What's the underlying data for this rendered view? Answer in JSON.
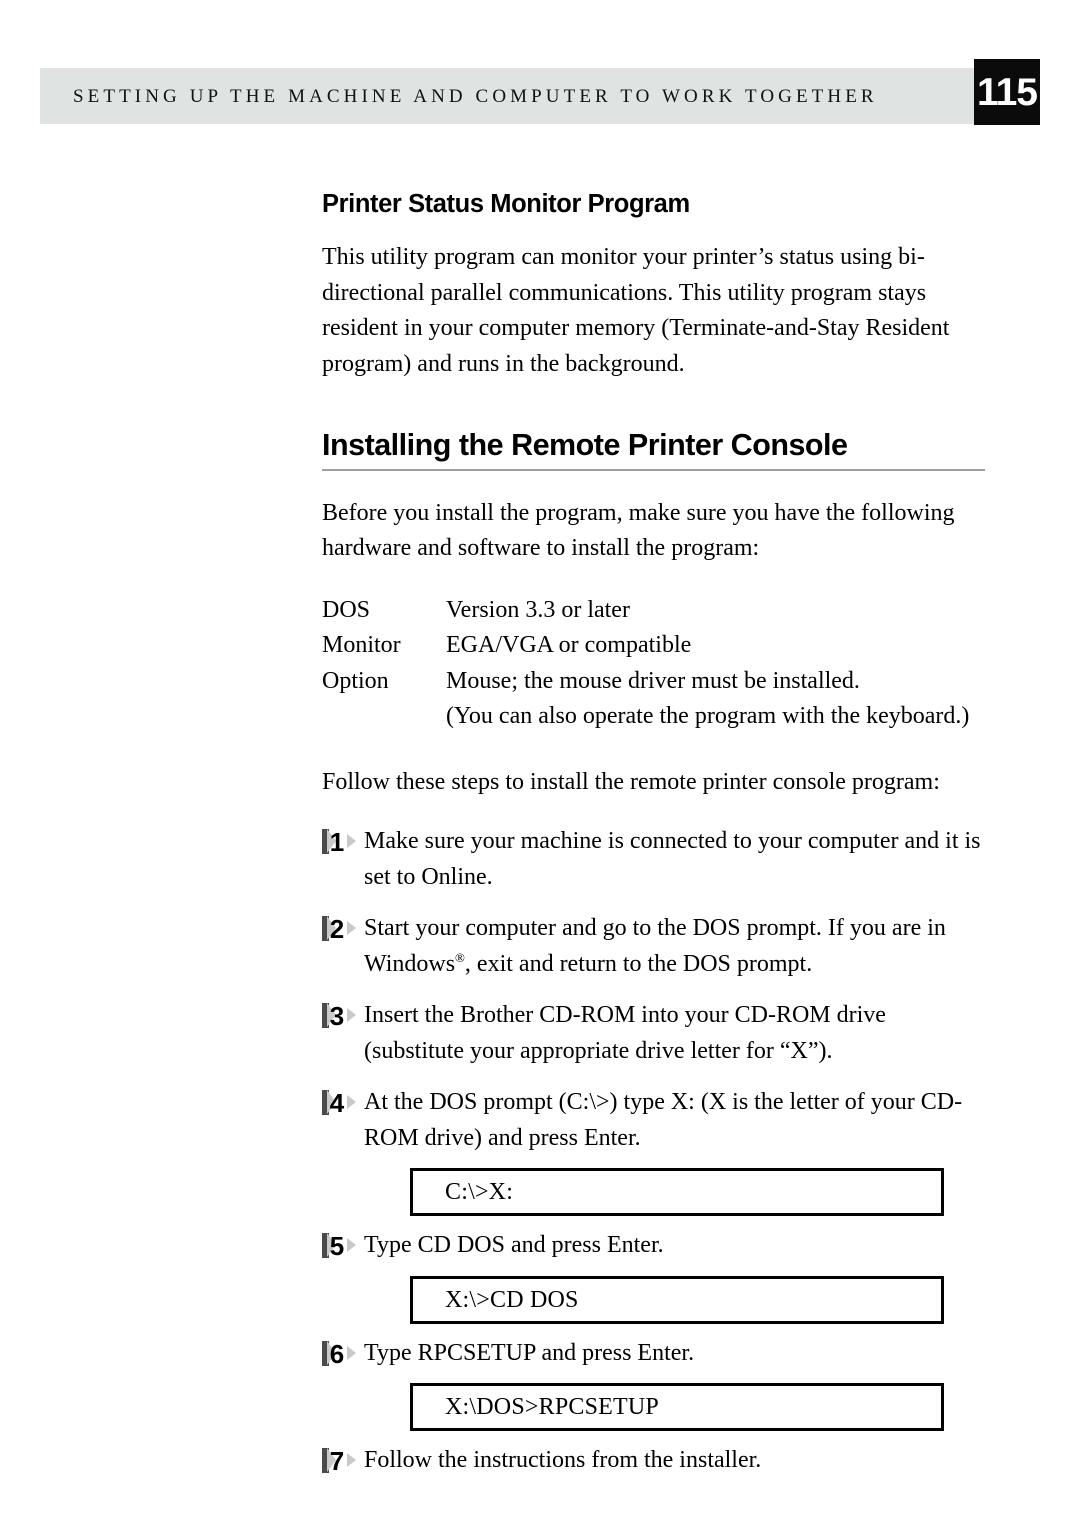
{
  "header": {
    "running_title": "SETTING UP THE  MACHINE AND COMPUTER TO WORK TOGETHER",
    "page_number": "115"
  },
  "sections": {
    "monitor": {
      "heading": "Printer Status Monitor Program",
      "paragraph": "This utility program can monitor your printer’s status using bi-directional parallel communications. This utility program stays resident in your computer memory (Terminate-and-Stay Resident program) and runs in the background."
    },
    "console": {
      "heading": "Installing the Remote Printer Console",
      "intro": "Before you install the program, make sure you have the following hardware and software to install the program:",
      "requirements": [
        {
          "label": "DOS",
          "value": "Version 3.3 or later"
        },
        {
          "label": "Monitor",
          "value": "EGA/VGA or compatible"
        },
        {
          "label": "Option",
          "value": "Mouse; the mouse driver must be installed."
        },
        {
          "label": "",
          "value": "(You can also operate the program with the keyboard.)"
        }
      ],
      "steps_intro": "Follow these steps to install the remote printer console program:",
      "steps": [
        {
          "number": "1",
          "text": "Make sure your machine is connected to your computer and it is set to Online."
        },
        {
          "number": "2",
          "text_before": "Start your computer and go to the DOS prompt. If you are in Windows",
          "superscript": "®",
          "text_after": ", exit and return to the DOS prompt."
        },
        {
          "number": "3",
          "text": "Insert the Brother CD-ROM into your CD-ROM drive (substitute your appropriate drive letter for “X”)."
        },
        {
          "number": "4",
          "text": "At the DOS prompt (C:\\>) type X: (X is the letter of your CD-ROM drive) and press Enter."
        },
        {
          "number": "5",
          "text": "Type CD DOS and press Enter."
        },
        {
          "number": "6",
          "text": "Type RPCSETUP and press Enter."
        },
        {
          "number": "7",
          "text": "Follow the instructions from the installer."
        }
      ],
      "command_boxes": [
        {
          "command": "C:\\>X:"
        },
        {
          "command": "X:\\>CD DOS"
        },
        {
          "command": "X:\\DOS>RPCSETUP"
        }
      ]
    }
  },
  "colors": {
    "header_band": "#dfe3e2",
    "page_number_box": "#0b0b0b",
    "rule": "#a0a0a0",
    "marker_gray": "#c9c9c9",
    "marker_dark": "#4a4a4a"
  }
}
